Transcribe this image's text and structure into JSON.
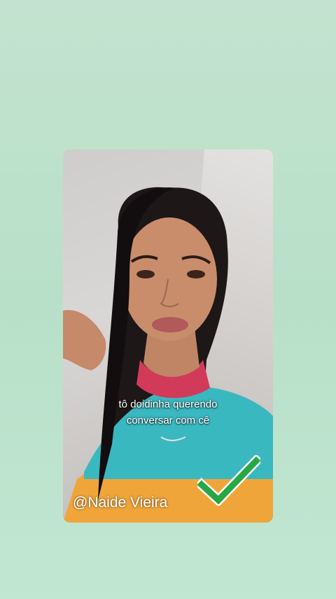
{
  "video": {
    "caption_line1": "tô doidinha querendo",
    "caption_line2": "conversar com cê",
    "handle": "@Naide Vieira",
    "check_icon_color": "#28a745",
    "background_color": "#bfe3cd"
  }
}
